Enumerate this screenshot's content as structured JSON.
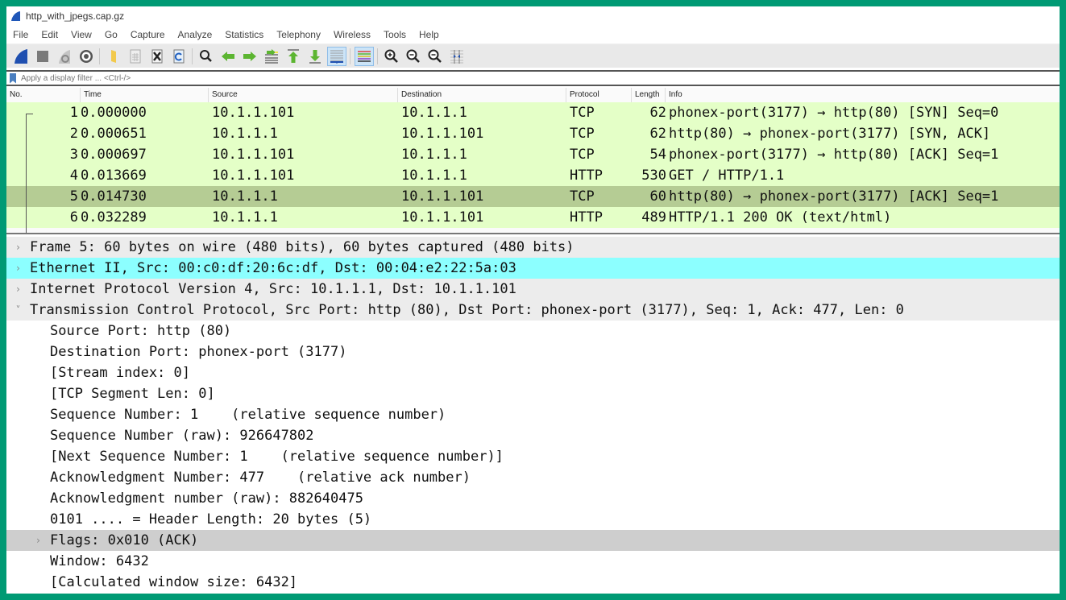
{
  "window": {
    "title": "http_with_jpegs.cap.gz"
  },
  "menu": [
    "File",
    "Edit",
    "View",
    "Go",
    "Capture",
    "Analyze",
    "Statistics",
    "Telephony",
    "Wireless",
    "Tools",
    "Help"
  ],
  "toolbar": {
    "icons": [
      "start-capture-icon",
      "stop-capture-icon",
      "restart-capture-icon",
      "capture-options-icon",
      "open-file-icon",
      "save-file-icon",
      "close-file-icon",
      "reload-file-icon",
      "find-packet-icon",
      "go-back-icon",
      "go-forward-icon",
      "go-to-packet-icon",
      "go-first-packet-icon",
      "go-last-packet-icon",
      "auto-scroll-icon",
      "colorize-icon",
      "zoom-in-icon",
      "zoom-out-icon",
      "normal-size-icon",
      "resize-columns-icon"
    ]
  },
  "filter": {
    "placeholder": "Apply a display filter ... <Ctrl-/>",
    "value": ""
  },
  "packet_list": {
    "columns": [
      "No.",
      "Time",
      "Source",
      "Destination",
      "Protocol",
      "Length",
      "Info"
    ],
    "selected_index": 4,
    "rows": [
      {
        "no": "1",
        "time": "0.000000",
        "source": "10.1.1.101",
        "destination": "10.1.1.1",
        "protocol": "TCP",
        "length": "62",
        "info": "phonex-port(3177) → http(80) [SYN] Seq=0"
      },
      {
        "no": "2",
        "time": "0.000651",
        "source": "10.1.1.1",
        "destination": "10.1.1.101",
        "protocol": "TCP",
        "length": "62",
        "info": "http(80) → phonex-port(3177) [SYN, ACK]"
      },
      {
        "no": "3",
        "time": "0.000697",
        "source": "10.1.1.101",
        "destination": "10.1.1.1",
        "protocol": "TCP",
        "length": "54",
        "info": "phonex-port(3177) → http(80) [ACK] Seq=1"
      },
      {
        "no": "4",
        "time": "0.013669",
        "source": "10.1.1.101",
        "destination": "10.1.1.1",
        "protocol": "HTTP",
        "length": "530",
        "info": "GET / HTTP/1.1"
      },
      {
        "no": "5",
        "time": "0.014730",
        "source": "10.1.1.1",
        "destination": "10.1.1.101",
        "protocol": "TCP",
        "length": "60",
        "info": "http(80) → phonex-port(3177) [ACK] Seq=1"
      },
      {
        "no": "6",
        "time": "0.032289",
        "source": "10.1.1.1",
        "destination": "10.1.1.101",
        "protocol": "HTTP",
        "length": "489",
        "info": "HTTP/1.1 200 OK  (text/html)"
      }
    ]
  },
  "details": {
    "frame": "Frame 5: 60 bytes on wire (480 bits), 60 bytes captured (480 bits)",
    "ethernet": "Ethernet II, Src: 00:c0:df:20:6c:df, Dst: 00:04:e2:22:5a:03",
    "ip": "Internet Protocol Version 4, Src: 10.1.1.1, Dst: 10.1.1.101",
    "tcp": "Transmission Control Protocol, Src Port: http (80), Dst Port: phonex-port (3177), Seq: 1, Ack: 477, Len: 0",
    "tcp_fields": [
      "Source Port: http (80)",
      "Destination Port: phonex-port (3177)",
      "[Stream index: 0]",
      "[TCP Segment Len: 0]",
      "Sequence Number: 1    (relative sequence number)",
      "Sequence Number (raw): 926647802",
      "[Next Sequence Number: 1    (relative sequence number)]",
      "Acknowledgment Number: 477    (relative ack number)",
      "Acknowledgment number (raw): 882640475",
      "0101 .... = Header Length: 20 bytes (5)"
    ],
    "flags": "Flags: 0x010 (ACK)",
    "tcp_fields_after": [
      "Window: 6432",
      "[Calculated window size: 6432]"
    ]
  }
}
